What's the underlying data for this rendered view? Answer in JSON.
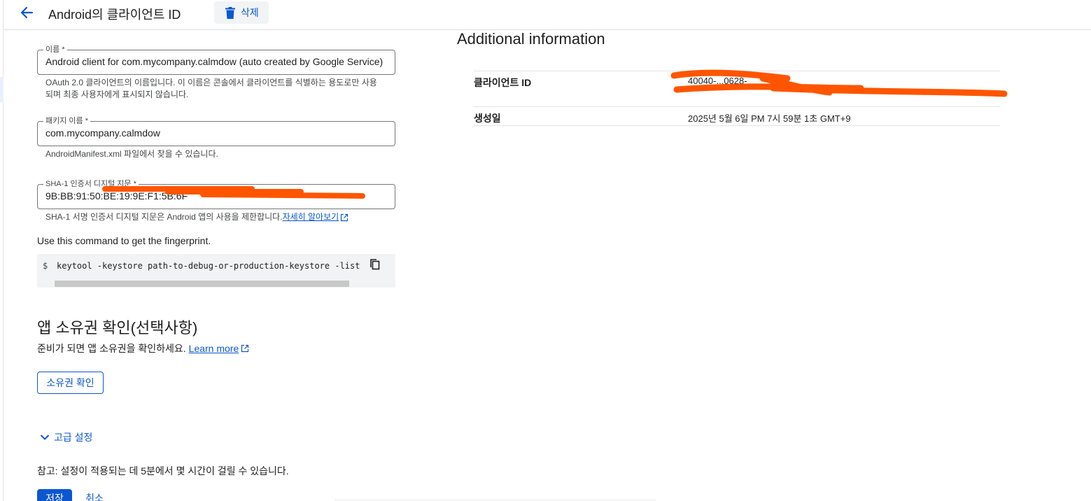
{
  "header": {
    "title": "Android의 클라이언트 ID",
    "delete_label": "삭제"
  },
  "form": {
    "name": {
      "label": "이름 *",
      "value": "Android client for com.mycompany.calmdow (auto created by Google Service)",
      "hint": "OAuth 2.0 클라이언트의 이름입니다. 이 이름은 콘솔에서 클라이언트를 식별하는 용도로만 사용되며 최종 사용자에게 표시되지 않습니다."
    },
    "package": {
      "label": "패키지 이름 *",
      "value": "com.mycompany.calmdow",
      "hint": "AndroidManifest.xml 파일에서 찾을 수 있습니다."
    },
    "sha1": {
      "label": "SHA-1 인증서 디지털 지문 *",
      "value": "9B:BB:91:50:BE:19:9E:F1:5B:6F",
      "hint": "SHA-1 서명 인증서 디지털 지문은 Android 앱의 사용을 제한합니다.",
      "hint_link": "자세히 알아보기"
    },
    "command_intro": "Use this command to get the fingerprint.",
    "command_prompt": "$",
    "command": "keytool -keystore path-to-debug-or-production-keystore -list"
  },
  "ownership": {
    "title": "앱 소유권 확인(선택사항)",
    "desc": "준비가 되면 앱 소유권을 확인하세요.",
    "learn_more": "Learn more",
    "verify_label": "소유권 확인"
  },
  "advanced": {
    "label": "고급 설정",
    "note": "참고: 설정이 적용되는 데 5분에서 몇 시간이 걸릴 수 있습니다."
  },
  "actions": {
    "save_label": "저장",
    "cancel_label": "취소"
  },
  "info": {
    "title": "Additional information",
    "rows": [
      {
        "key": "클라이언트 ID",
        "value": "40040-...0628-"
      },
      {
        "key": "생성일",
        "value": "2025년 5월 6일 PM 7시 59분 1초 GMT+9"
      }
    ]
  },
  "colors": {
    "accent": "#0b57d0",
    "redaction": "#ff5500"
  },
  "icons": {
    "back": "arrow-left-icon",
    "delete": "trash-icon",
    "copy": "copy-icon",
    "external": "open-in-new-icon",
    "expand": "chevron-down-icon"
  }
}
